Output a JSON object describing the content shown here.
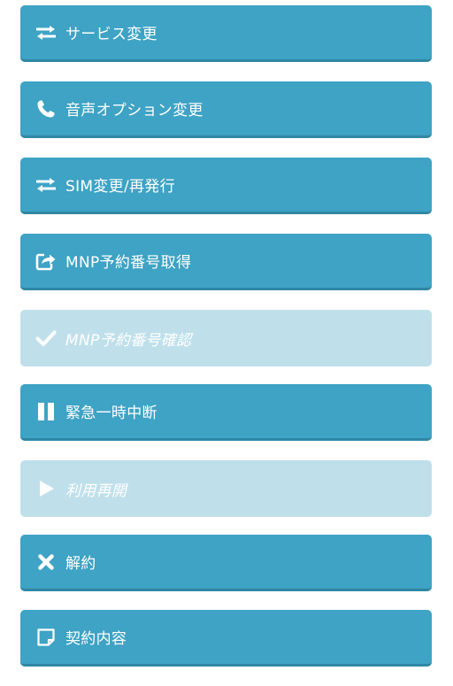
{
  "colors": {
    "primary_button": "#3ea3c4",
    "primary_button_shadow": "#2f87a4",
    "disabled_button": "#bfe0eb",
    "text": "#ffffff"
  },
  "menu": {
    "items": [
      {
        "label": "サービス変更",
        "icon": "swap-arrows-icon",
        "enabled": true
      },
      {
        "label": "音声オプション変更",
        "icon": "phone-icon",
        "enabled": true
      },
      {
        "label": "SIM変更/再発行",
        "icon": "swap-arrows-icon",
        "enabled": true
      },
      {
        "label": "MNP予約番号取得",
        "icon": "share-external-icon",
        "enabled": true
      },
      {
        "label": "MNP予約番号確認",
        "icon": "check-icon",
        "enabled": false
      },
      {
        "label": "緊急一時中断",
        "icon": "pause-icon",
        "enabled": true
      },
      {
        "label": "利用再開",
        "icon": "play-icon",
        "enabled": false
      },
      {
        "label": "解約",
        "icon": "close-icon",
        "enabled": true
      },
      {
        "label": "契約内容",
        "icon": "document-icon",
        "enabled": true
      }
    ]
  }
}
